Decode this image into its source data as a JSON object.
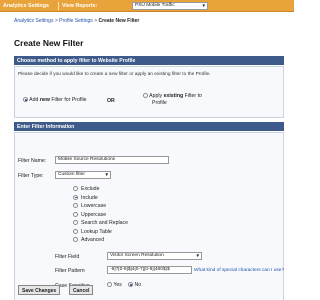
{
  "topbar": {
    "analytics_settings": "Analytics Settings",
    "view_reports_label": "View Reports:",
    "profile_select": "PSU Mobile Traffic"
  },
  "breadcrumb": {
    "part1": "Analytics Settings",
    "sep1": " > ",
    "part2": "Profile Settings",
    "sep2": " > ",
    "current": "Create New Filter"
  },
  "page_title": "Create New Filter",
  "method_section": {
    "header": "Choose method to apply filter to Website Profile",
    "description": "Please decide if you would like to create a new filter or apply an existing filter to the Profile.",
    "option_new_prefix": "Add ",
    "option_new_bold": "new",
    "option_new_suffix": " Filter for Profile",
    "or_label": "OR",
    "option_existing_prefix": "Apply ",
    "option_existing_bold": "existing",
    "option_existing_suffix": " Filter to",
    "option_existing_line2": "Profile"
  },
  "info_section": {
    "header": "Enter Filter Information",
    "filter_name_label": "Filter Name:",
    "filter_name_value": "Mobile Source Resolutions",
    "filter_type_label": "Filter Type:",
    "filter_type_value": "Custom filter",
    "type_options": [
      "Exclude",
      "Include",
      "Lowercase",
      "Uppercase",
      "Search and Replace",
      "Lookup Table",
      "Advanced"
    ],
    "selected_option_index": 1,
    "filter_field_label": "Filter Field",
    "filter_field_value": "Visitor Screen Resolution",
    "filter_pattern_label": "Filter Pattern",
    "filter_pattern_value": "-9]?[0-9]$|4[0-7][0-9]|480$)$",
    "pattern_help_link": "What kind of special characters can I use?",
    "case_sensitive_label": "Case Sensitive",
    "yes_label": "Yes",
    "no_label": "No",
    "case_sensitive_value": "No"
  },
  "buttons": {
    "save": "Save Changes",
    "cancel": "Cancel"
  },
  "colors": {
    "topbar": "#e8a43a",
    "section_header": "#3d5a8a",
    "link": "#2255aa"
  }
}
